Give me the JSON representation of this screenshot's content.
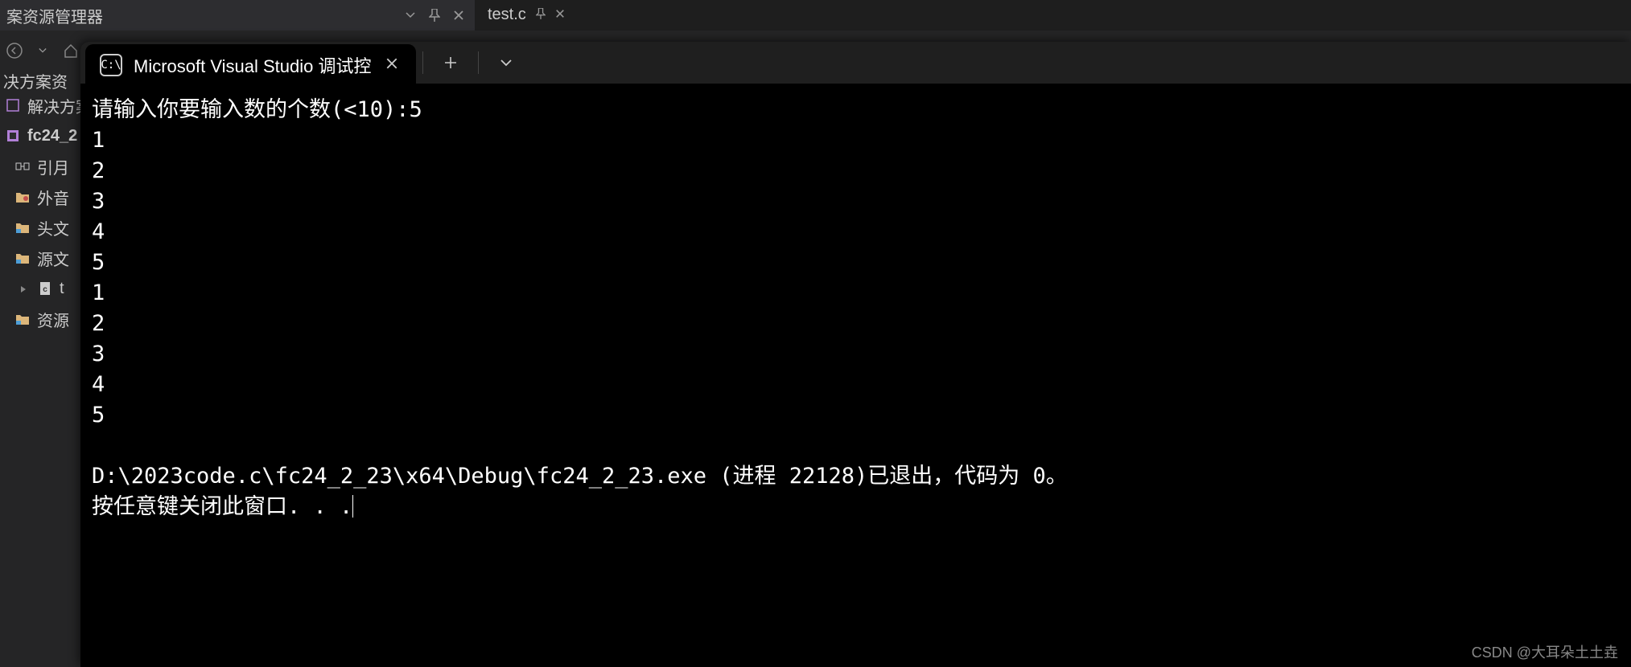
{
  "panel": {
    "title": "案资源管理器"
  },
  "explorer": {
    "heading": "决方案资",
    "solution_line": "解决方案 \"",
    "tree": [
      {
        "label": "fc24_2",
        "icon": "project",
        "bold": true
      },
      {
        "label": "引月",
        "icon": "reference"
      },
      {
        "label": "外音",
        "icon": "external"
      },
      {
        "label": "头文",
        "icon": "folder"
      },
      {
        "label": "源文",
        "icon": "folder"
      },
      {
        "label": "t",
        "icon": "cfile"
      },
      {
        "label": "资源",
        "icon": "folder"
      }
    ]
  },
  "editor": {
    "tab_label": "test.c"
  },
  "terminal": {
    "tab_title": "Microsoft Visual Studio 调试控",
    "lines": [
      "请输入你要输入数的个数(<10):5",
      "1",
      "2",
      "3",
      "4",
      "5",
      "1",
      "2",
      "3",
      "4",
      "5",
      "",
      "D:\\2023code.c\\fc24_2_23\\x64\\Debug\\fc24_2_23.exe (进程 22128)已退出，代码为 0。",
      "按任意键关闭此窗口. . ."
    ]
  },
  "watermark": "CSDN @大耳朵土土垚"
}
